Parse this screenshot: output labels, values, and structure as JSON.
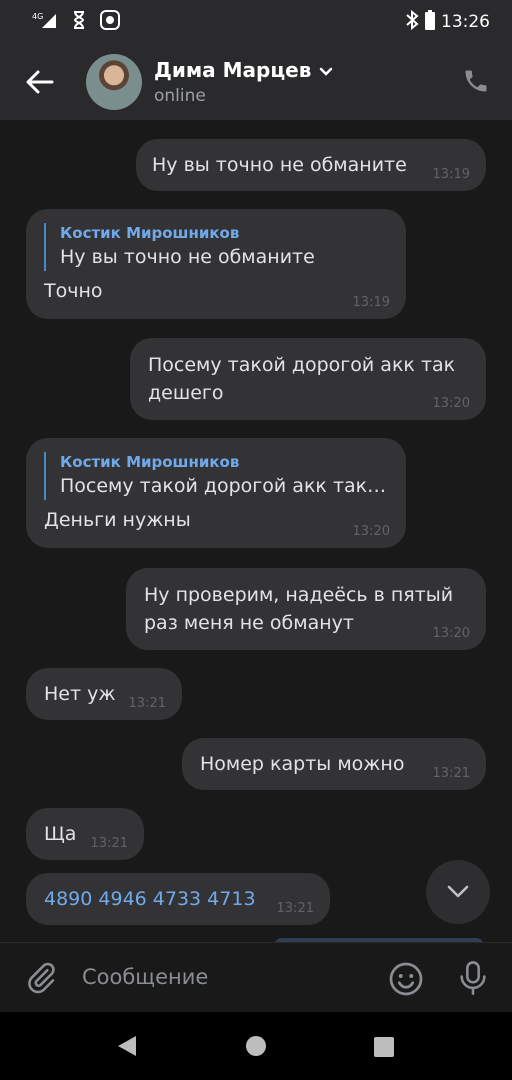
{
  "statusbar": {
    "network": "4G",
    "time": "13:26"
  },
  "header": {
    "contact_name": "Дима Марцев",
    "status": "online"
  },
  "messages": [
    {
      "direction": "out",
      "text": "Ну вы точно не обманите",
      "time": "13:19"
    },
    {
      "direction": "in",
      "reply_author": "Костик Мирошников",
      "reply_text": "Ну вы точно не обманите",
      "text": "Точно",
      "time": "13:19"
    },
    {
      "direction": "out",
      "text": "Посему такой дорогой акк так дешего",
      "time": "13:20"
    },
    {
      "direction": "in",
      "reply_author": "Костик Мирошников",
      "reply_text": "Посему такой дорогой акк так…",
      "text": "Деньги нужны",
      "time": "13:20"
    },
    {
      "direction": "out",
      "text": "Ну проверим, надеёсь в пятый раз меня не обманут",
      "time": "13:20"
    },
    {
      "direction": "in",
      "text": "Нет уж",
      "time": "13:21"
    },
    {
      "direction": "out",
      "text": "Номер карты можно",
      "time": "13:21"
    },
    {
      "direction": "in",
      "text": "Ща",
      "time": "13:21"
    },
    {
      "direction": "in",
      "text": "4890 4946 4733 4713",
      "time": "13:21",
      "is_link": true
    }
  ],
  "composer": {
    "placeholder": "Сообщение"
  },
  "colors": {
    "bubble": "#333336",
    "link": "#71aaeb",
    "accent_bar": "#4a88c7",
    "background": "#19191a"
  }
}
